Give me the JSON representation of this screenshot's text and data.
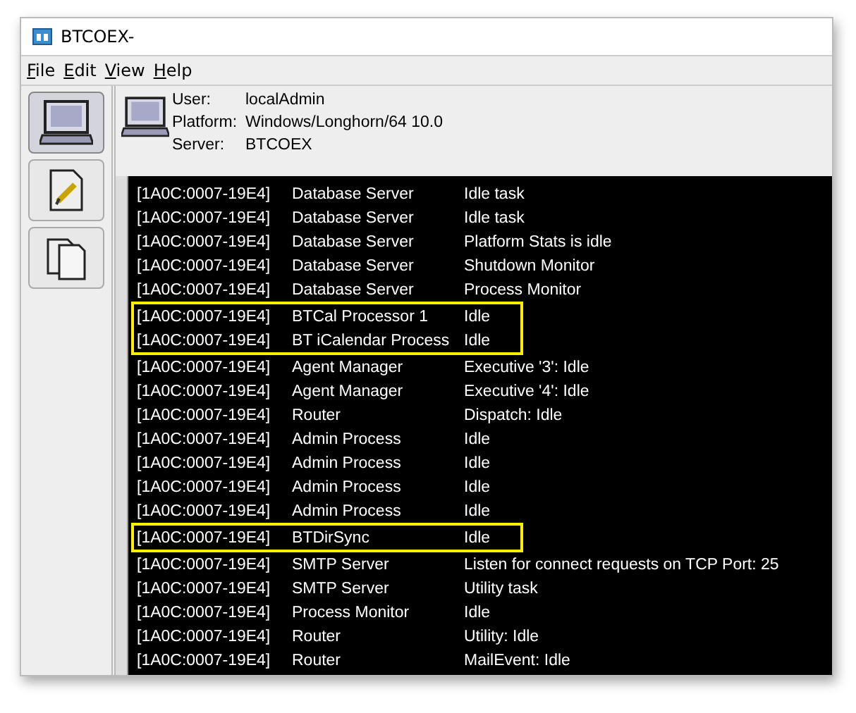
{
  "window": {
    "title": "BTCOEX-"
  },
  "menu": [
    {
      "label": "File"
    },
    {
      "label": "Edit"
    },
    {
      "label": "View"
    },
    {
      "label": "Help"
    }
  ],
  "toolbar": [
    {
      "kind": "computer",
      "selected": true
    },
    {
      "kind": "document",
      "selected": false
    },
    {
      "kind": "documents",
      "selected": false
    }
  ],
  "info": [
    {
      "label": "User:",
      "value": "localAdmin"
    },
    {
      "label": "Platform:",
      "value": "Windows/Longhorn/64 10.0"
    },
    {
      "label": "Server:",
      "value": "BTCOEX"
    }
  ],
  "log": [
    {
      "id": "[1A0C:0007-19E4]",
      "source": "Database Server",
      "message": "Idle task",
      "highlighted": false
    },
    {
      "id": "[1A0C:0007-19E4]",
      "source": "Database Server",
      "message": "Idle task",
      "highlighted": false
    },
    {
      "id": "[1A0C:0007-19E4]",
      "source": "Database Server",
      "message": "Platform Stats is idle",
      "highlighted": false
    },
    {
      "id": "[1A0C:0007-19E4]",
      "source": "Database Server",
      "message": "Shutdown Monitor",
      "highlighted": false
    },
    {
      "id": "[1A0C:0007-19E4]",
      "source": "Database Server",
      "message": "Process Monitor",
      "highlighted": false
    },
    {
      "id": "[1A0C:0007-19E4]",
      "source": "BTCal Processor 1",
      "message": "Idle",
      "highlighted": true
    },
    {
      "id": "[1A0C:0007-19E4]",
      "source": "BT iCalendar Process",
      "message": "Idle",
      "highlighted": true
    },
    {
      "id": "[1A0C:0007-19E4]",
      "source": "Agent Manager",
      "message": "Executive '3': Idle",
      "highlighted": false
    },
    {
      "id": "[1A0C:0007-19E4]",
      "source": "Agent Manager",
      "message": "Executive '4': Idle",
      "highlighted": false
    },
    {
      "id": "[1A0C:0007-19E4]",
      "source": "Router",
      "message": "Dispatch: Idle",
      "highlighted": false
    },
    {
      "id": "[1A0C:0007-19E4]",
      "source": "Admin Process",
      "message": "Idle",
      "highlighted": false
    },
    {
      "id": "[1A0C:0007-19E4]",
      "source": "Admin Process",
      "message": "Idle",
      "highlighted": false
    },
    {
      "id": "[1A0C:0007-19E4]",
      "source": "Admin Process",
      "message": "Idle",
      "highlighted": false
    },
    {
      "id": "[1A0C:0007-19E4]",
      "source": "Admin Process",
      "message": "Idle",
      "highlighted": false
    },
    {
      "id": "[1A0C:0007-19E4]",
      "source": "BTDirSync",
      "message": "Idle",
      "highlighted": true
    },
    {
      "id": "[1A0C:0007-19E4]",
      "source": "SMTP Server",
      "message": "Listen for connect requests on TCP Port: 25",
      "highlighted": false
    },
    {
      "id": "[1A0C:0007-19E4]",
      "source": "SMTP Server",
      "message": "Utility task",
      "highlighted": false
    },
    {
      "id": "[1A0C:0007-19E4]",
      "source": "Process Monitor",
      "message": "Idle",
      "highlighted": false
    },
    {
      "id": "[1A0C:0007-19E4]",
      "source": "Router",
      "message": "Utility: Idle",
      "highlighted": false
    },
    {
      "id": "[1A0C:0007-19E4]",
      "source": "Router",
      "message": "MailEvent: Idle",
      "highlighted": false
    }
  ]
}
